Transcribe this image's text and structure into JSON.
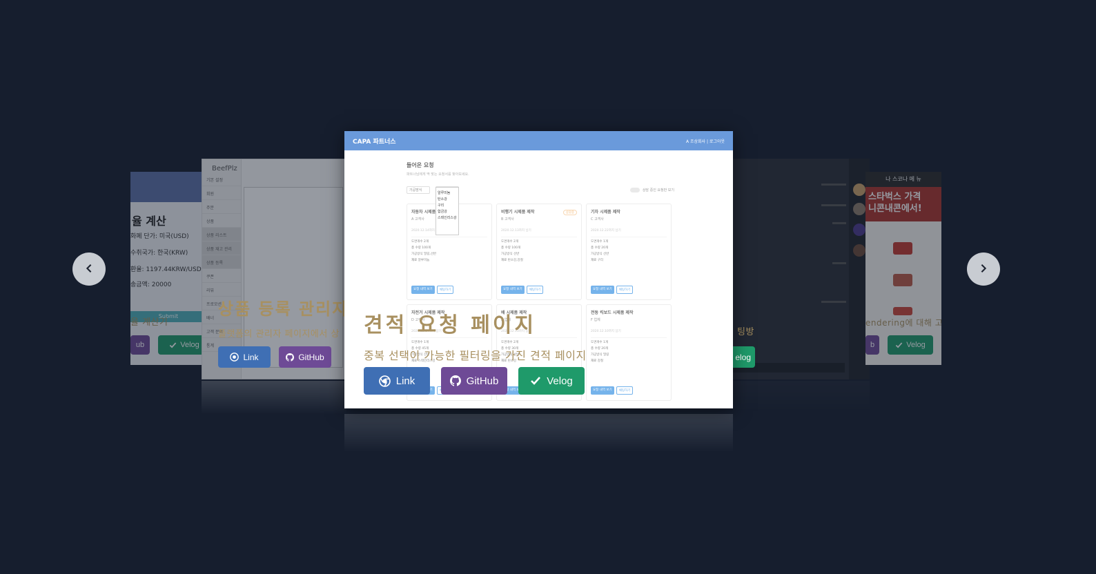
{
  "carousel": {
    "slides": [
      {
        "id": "currency",
        "title_fragment": "율 계산",
        "rows": [
          "화폐 단가: 미국(USD)",
          "수취국가: 한국(KRW)",
          "환율: 1197.44KRW/USD",
          "송금액: 20000"
        ],
        "submit": "Submit",
        "caption": "율 계산기",
        "velog": "Velog",
        "github_fragment": "ub"
      },
      {
        "id": "admin",
        "brand": "BeefPlz",
        "menu": [
          "기본 설정",
          "회원",
          "주문",
          "상품",
          "상품 리스트",
          "상품 재고 관리",
          "상품 등록",
          "쿠폰",
          "리뷰",
          "프로모션",
          "배너",
          "고객 문의",
          "통계"
        ],
        "title": "상품 등록 관리자",
        "desc": "플랫폼의 관리자 페이지에서 상",
        "link": "Link",
        "github": "GitHub"
      },
      {
        "id": "estimate",
        "nav_brand": "CAPA 파트너스",
        "nav_right": "A 조상회사  |  로그아웃",
        "heading": "들어온 요청",
        "subheading": "파트너님에게 딱 맞는 요청서를 찾아보세요.",
        "filter1": "가공방식",
        "filter2": "재료",
        "toggle": "상담 중인 요청만 보기",
        "dropdown": [
          "알루미늄",
          "탄소강",
          "구리",
          "합금강",
          "스테인리스강"
        ],
        "cards": [
          {
            "title": "자동차 시제품 제작",
            "client": "A 고객사",
            "date": "2020.12.14까지 납기",
            "kv": [
              "도면개수  2개",
              "총 수량  100개",
              "가공방식  밀링,선반",
              "재료  알루미늄"
            ],
            "tag": ""
          },
          {
            "title": "비행기 시제품 제작",
            "client": "B 고객사",
            "date": "2020.12.13까지 납기",
            "kv": [
              "도면개수  2개",
              "총 수량  100개",
              "가공방식  선반",
              "재료  탄소강,강철"
            ],
            "tag": "상담중"
          },
          {
            "title": "기차 시제품 제작",
            "client": "C 고객사",
            "date": "2020.12.22까지 납기",
            "kv": [
              "도면개수  1개",
              "총 수량  20개",
              "가공방식  선반",
              "재료  구리"
            ],
            "tag": ""
          },
          {
            "title": "자전거 시제품 제작",
            "client": "D 고객사",
            "date": "2020.12.14까지 납기",
            "kv": [
              "도면개수  1개",
              "총 수량  45개",
              "가공방식  선반",
              "재료  스테인리스강"
            ],
            "tag": ""
          },
          {
            "title": "배 시제품 제작",
            "client": "E 업체",
            "date": "2020.12.13까지 납기",
            "kv": [
              "도면개수  2개",
              "총 수량  30개",
              "가공방식  선반",
              "재료  탄소강"
            ],
            "tag": ""
          },
          {
            "title": "전동 킥보드 시제품 제작",
            "client": "F 업체",
            "date": "2020.12.10까지 납기",
            "kv": [
              "도면개수  1개",
              "총 수량  20개",
              "가공방식  밀링",
              "재료  강철"
            ],
            "tag": ""
          }
        ],
        "btn_view": "요청 내역 보기",
        "btn_chat": "채팅하기",
        "title": "견적 요청 페이지",
        "desc": "중복 선택이 가능한 필터링을 가진 견적 페이지",
        "link": "Link",
        "github": "GitHub",
        "velog": "Velog"
      },
      {
        "id": "chat",
        "caption_fragment": "팅방",
        "velog_fragment": "elog"
      },
      {
        "id": "starbucks",
        "header": "나 스코나 메 뉴",
        "banner": "스타벅스  가격\n니콘내콘에서!",
        "caption_fragment": "endering에 대해 고민",
        "github_fragment": "b",
        "velog": "Velog"
      }
    ],
    "colors": {
      "background": "#161e2e",
      "link": "#3f6fb4",
      "github": "#6e4a96",
      "velog": "#1f9a6a",
      "caption": "#a89060"
    }
  }
}
